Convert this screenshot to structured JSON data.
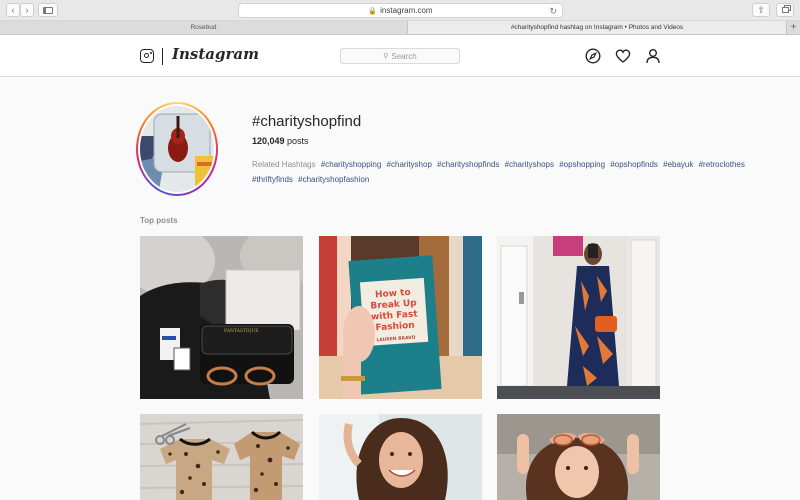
{
  "browser": {
    "url": "instagram.com",
    "tabs": [
      {
        "label": "Rosebud"
      },
      {
        "label": "#charityshopfind hashtag on Instagram • Photos and Videos"
      }
    ]
  },
  "header": {
    "wordmark": "Instagram",
    "search_placeholder": "Search"
  },
  "hashtag": {
    "title": "#charityshopfind",
    "post_count": "120,049",
    "post_count_suffix": " posts",
    "related_label": "Related Hashtags",
    "related": [
      "#charityshopping",
      "#charityshop",
      "#charityshopfinds",
      "#charityshops",
      "#opshopping",
      "#opshopfinds",
      "#ebayuk",
      "#retroclothes",
      "#thriftyfinds",
      "#charityshopfashion"
    ]
  },
  "top_posts_label": "Top posts",
  "book": {
    "line1": "How to",
    "line2": "Break Up",
    "line3": "with Fast",
    "line4": "Fashion",
    "author": "LAUREN BRAVO"
  },
  "colors": {
    "link": "#385185",
    "muted": "#8e8e8e",
    "text": "#262626"
  }
}
